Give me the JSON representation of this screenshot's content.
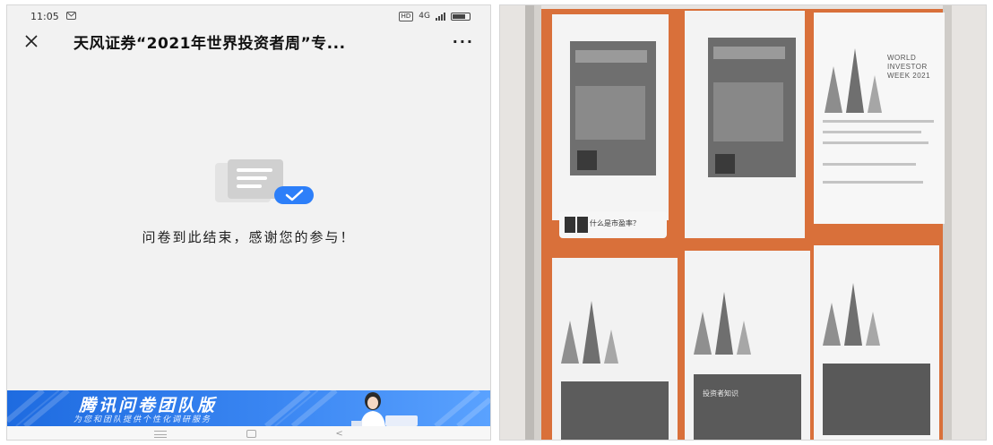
{
  "status_bar": {
    "time": "11:05",
    "hd": "HD",
    "network": "4G"
  },
  "nav": {
    "close_icon": "close-icon",
    "title": "天风证券“2021年世界投资者周”专...",
    "more": "···"
  },
  "end_message": "问卷到此结束，感谢您的参与！",
  "banner": {
    "title": "腾讯问卷团队版",
    "subtitle": "为您和团队提供个性化调研服务"
  },
  "home_bar": {
    "menu_icon": "menu-icon",
    "home_icon": "home-icon",
    "back_icon": "back-icon",
    "back": "<"
  },
  "photo": {
    "poster_sign": "什么是市盈率？",
    "poster_title": "WORLD INVESTOR WEEK 2021",
    "poster_title_lines": [
      "WORLD",
      "INVESTOR",
      "WEEK 2021"
    ],
    "poster_knowledge": "投资者知识"
  },
  "colors": {
    "banner_blue": "#2f7cf0",
    "check_blue": "#2d7ff9",
    "board_orange": "#d9703a"
  }
}
